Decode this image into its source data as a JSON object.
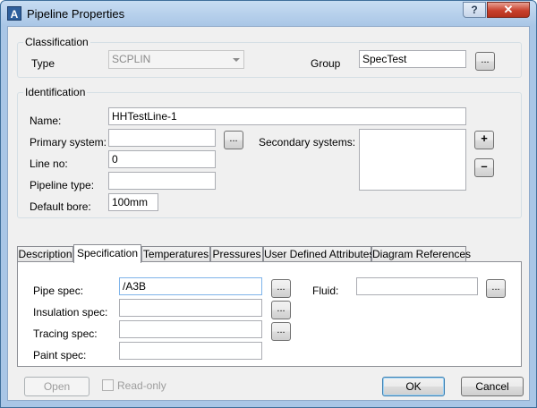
{
  "window": {
    "title": "Pipeline Properties",
    "help_label": "?",
    "close_label": "✕"
  },
  "classification": {
    "title": "Classification",
    "type_label": "Type",
    "type_value": "SCPLIN",
    "group_label": "Group",
    "group_value": "SpecTest",
    "browse_label": "..."
  },
  "identification": {
    "title": "Identification",
    "name_label": "Name:",
    "name_value": "HHTestLine-1",
    "primary_system_label": "Primary system:",
    "primary_system_value": "",
    "browse_label": "...",
    "secondary_systems_label": "Secondary systems:",
    "add_label": "+",
    "remove_label": "–",
    "line_no_label": "Line no:",
    "line_no_value": "0",
    "pipeline_type_label": "Pipeline type:",
    "pipeline_type_value": "",
    "default_bore_label": "Default bore:",
    "default_bore_value": "100mm"
  },
  "tabs": [
    {
      "label": "Description"
    },
    {
      "label": "Specification"
    },
    {
      "label": "Temperatures"
    },
    {
      "label": "Pressures"
    },
    {
      "label": "User Defined Attributes"
    },
    {
      "label": "Diagram References"
    }
  ],
  "active_tab": "Specification",
  "specification": {
    "pipe_spec_label": "Pipe spec:",
    "pipe_spec_value": "/A3B",
    "insulation_spec_label": "Insulation spec:",
    "insulation_spec_value": "",
    "tracing_spec_label": "Tracing spec:",
    "tracing_spec_value": "",
    "paint_spec_label": "Paint spec:",
    "paint_spec_value": "",
    "fluid_label": "Fluid:",
    "fluid_value": "",
    "browse_label": "..."
  },
  "footer": {
    "open_label": "Open",
    "readonly_label": "Read-only",
    "ok_label": "OK",
    "cancel_label": "Cancel"
  }
}
